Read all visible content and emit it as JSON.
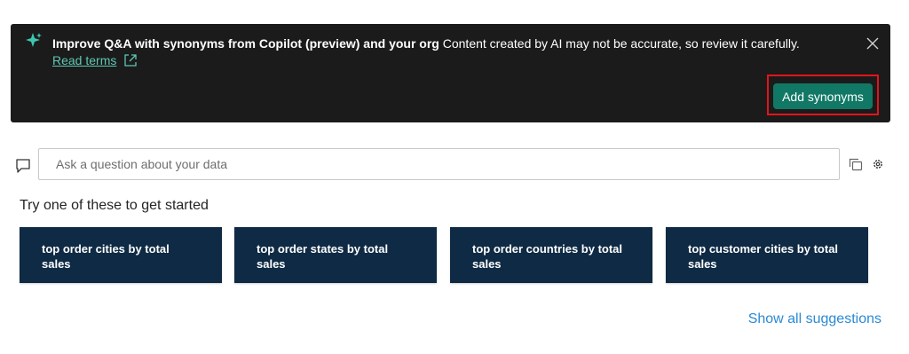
{
  "banner": {
    "title": "Improve Q&A with synonyms from Copilot (preview) and your org",
    "message": "Content created by AI may not be accurate, so review it carefully.",
    "read_terms": "Read terms",
    "add_synonyms_label": "Add synonyms",
    "icons": {
      "spark": "copilot-sparkle-icon",
      "external": "external-link-icon",
      "close": "close-icon"
    },
    "colors": {
      "background": "#1b1b1b",
      "accent": "#117865",
      "link": "#5fc7b4",
      "highlight": "#e3141b"
    }
  },
  "qa": {
    "placeholder": "Ask a question about your data",
    "value": "",
    "icons": {
      "left": "chat-bubble-icon",
      "right1": "copy-icon",
      "right2": "gear-icon"
    }
  },
  "suggestions": {
    "heading": "Try one of these to get started",
    "items": [
      "top order cities by total sales",
      "top order states by total sales",
      "top order countries by total sales",
      "top customer cities by total sales"
    ],
    "card_color": "#0f2a44",
    "show_all_label": "Show all suggestions"
  }
}
